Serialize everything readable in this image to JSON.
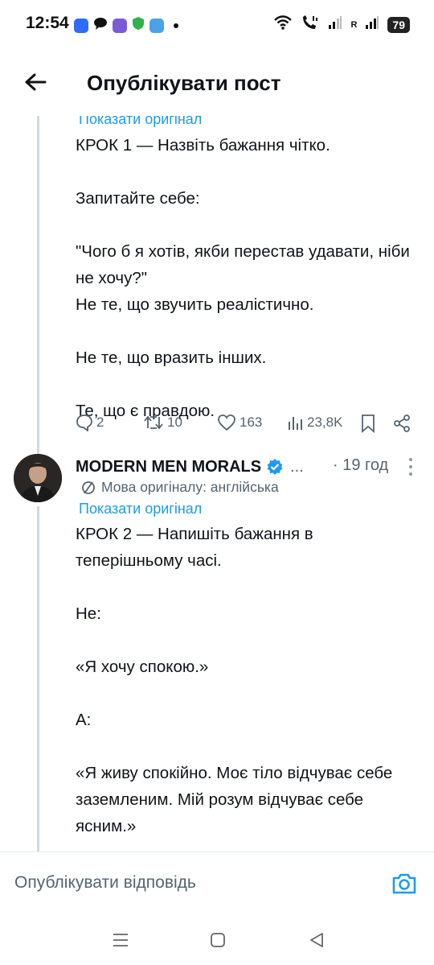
{
  "status_bar": {
    "time": "12:54",
    "battery": "79",
    "signal_label": "R"
  },
  "header": {
    "title": "Опублікувати пост",
    "back_icon": "arrow-left-icon"
  },
  "prev_tweet": {
    "show_original": "Показати оригінал",
    "text": "КРОК 1 — Назвіть бажання чітко.\n\nЗапитайте себе:\n\n\"Чого б я хотів, якби перестав удавати, ніби не хочу?\"\nНе те, що звучить реалістично.\n\nНе те, що вразить інших.\n\nТе, що є правдою.",
    "replies": "2",
    "reposts": "10",
    "likes": "163",
    "views": "23,8K"
  },
  "tweet": {
    "author": "MODERN MEN MORALS",
    "ellipsis": "...",
    "time": "· 19 год",
    "language_note": "Мова оригіналу: англійська",
    "show_original": "Показати оригінал",
    "text": "КРОК 2 — Напишіть бажання в теперішньому часі.\n\nНе:\n\n«Я хочу спокою.»\n\nА:\n\n«Я живу спокійно. Моє тіло відчуває себе заземленим. Мій розум відчуває себе ясним.»\n\nЮнг вважав, що несвідоме не реагує на"
  },
  "reply_bar": {
    "placeholder": "Опублікувати відповідь"
  },
  "colors": {
    "accent": "#1d9bf0",
    "text": "#0f1419",
    "muted": "#536471"
  }
}
